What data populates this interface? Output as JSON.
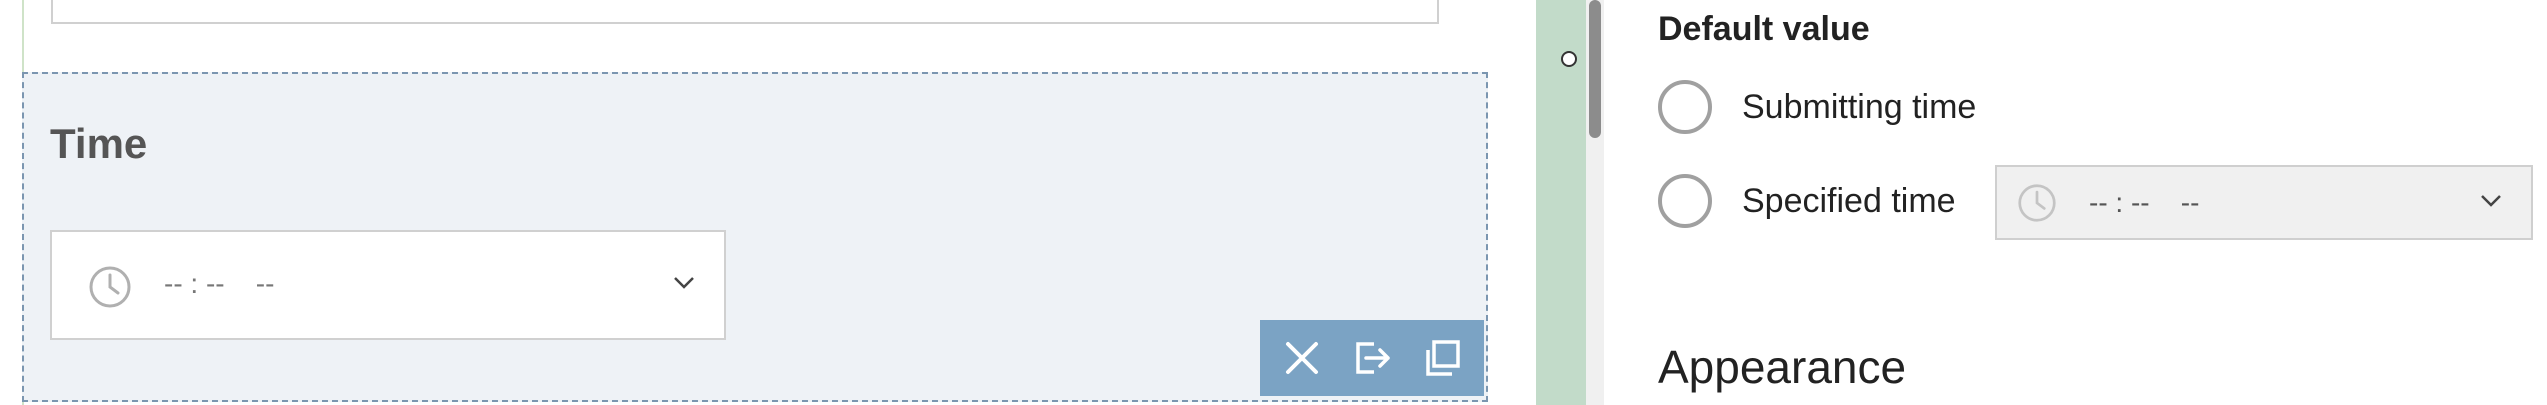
{
  "question": {
    "title": "Time",
    "time_placeholder": "-- : --    --"
  },
  "toolbar": {
    "icons": [
      "close-icon",
      "export-icon",
      "copy-icon"
    ]
  },
  "settings": {
    "default_value_label": "Default value",
    "options": [
      {
        "label": "Submitting time",
        "selected": false
      },
      {
        "label": "Specified time",
        "selected": false
      }
    ],
    "specified_time_placeholder": "-- : --    --",
    "appearance_heading": "Appearance"
  },
  "colors": {
    "selection_bg": "#eef2f6",
    "toolbar_bg": "#7ba3c4",
    "green_bar": "#c2dbc9"
  }
}
